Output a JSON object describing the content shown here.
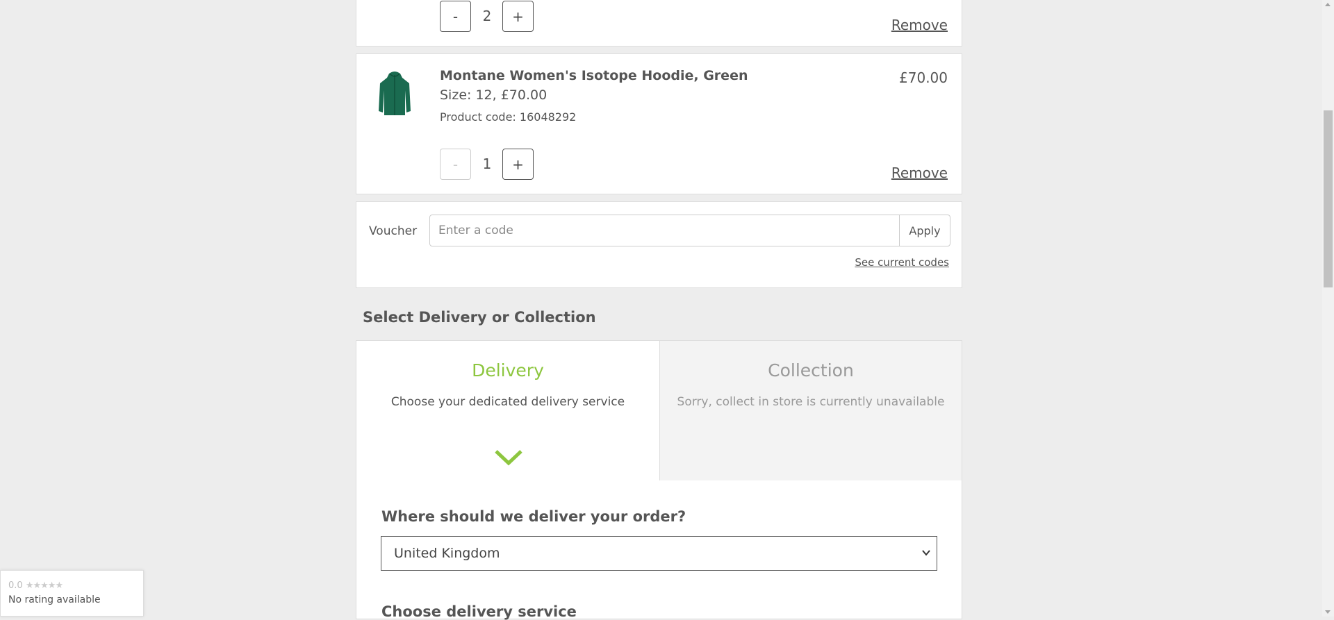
{
  "cart": {
    "item1": {
      "quantity": "2",
      "minus_label": "-",
      "plus_label": "+",
      "remove_label": "Remove"
    },
    "item2": {
      "title": "Montane Women's Isotope Hoodie, Green",
      "size_line": "Size: 12, £70.00",
      "product_code": "Product code: 16048292",
      "price": "£70.00",
      "quantity": "1",
      "minus_label": "-",
      "plus_label": "+",
      "remove_label": "Remove",
      "image_color": "#1a6b50"
    }
  },
  "voucher": {
    "label": "Voucher",
    "placeholder": "Enter a code",
    "apply_label": "Apply",
    "see_codes_label": "See current codes"
  },
  "delivery_section": {
    "title": "Select Delivery or Collection",
    "delivery": {
      "title": "Delivery",
      "description": "Choose your dedicated delivery service",
      "accent": "#8dc63f"
    },
    "collection": {
      "title": "Collection",
      "description": "Sorry, collect in store is currently unavailable"
    }
  },
  "address": {
    "question": "Where should we deliver your order?",
    "country": "United Kingdom",
    "next_heading": "Choose delivery service"
  },
  "rating_widget": {
    "score": "0.0",
    "stars": "★★★★★",
    "status": "No rating available"
  }
}
